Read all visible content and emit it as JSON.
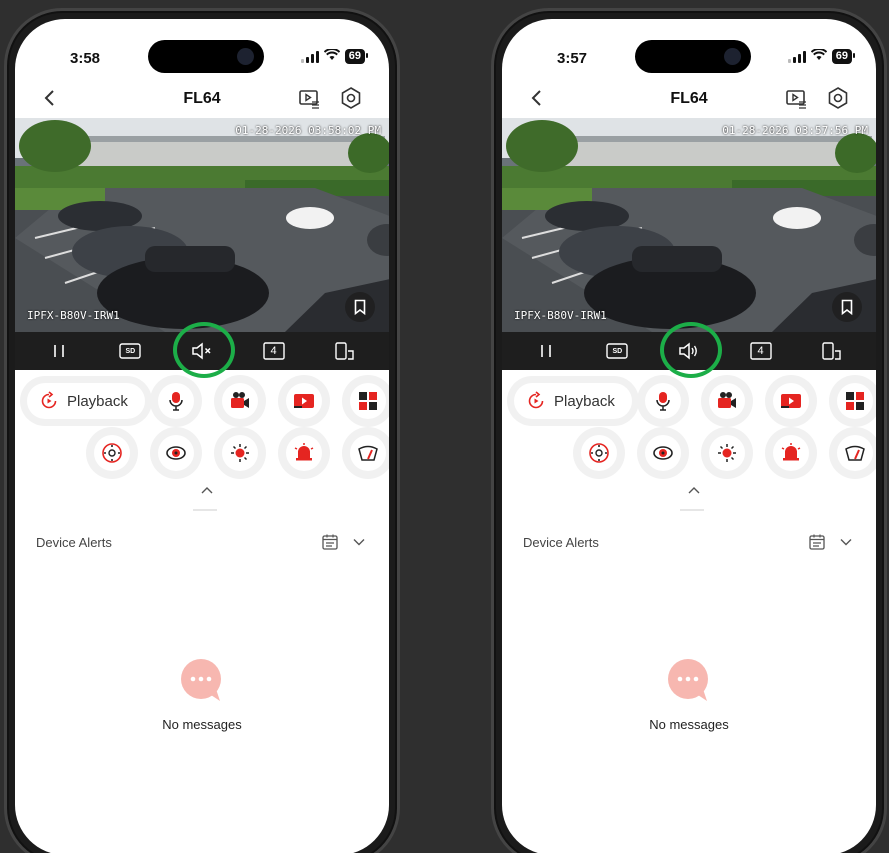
{
  "phones": [
    {
      "status": {
        "time": "3:58",
        "battery": "69"
      },
      "nav": {
        "title": "FL64"
      },
      "video": {
        "timestamp": "01-28-2026 03:58:02 PM",
        "camera_label": "IPFX-B80V-IRW1"
      },
      "controls": {
        "quality": "SD",
        "audio_state": "muted",
        "split_count": "4"
      },
      "functions": {
        "playback_label": "Playback"
      },
      "alerts": {
        "title": "Device Alerts",
        "empty_text": "No messages"
      }
    },
    {
      "status": {
        "time": "3:57",
        "battery": "69"
      },
      "nav": {
        "title": "FL64"
      },
      "video": {
        "timestamp": "01-28-2026 03:57:56 PM",
        "camera_label": "IPFX-B80V-IRW1"
      },
      "controls": {
        "quality": "SD",
        "audio_state": "unmuted",
        "split_count": "4"
      },
      "functions": {
        "playback_label": "Playback"
      },
      "alerts": {
        "title": "Device Alerts",
        "empty_text": "No messages"
      }
    }
  ],
  "colors": {
    "highlight": "#1cae48",
    "accent_red": "#e52521",
    "bubble_pink": "#f7b7b0"
  },
  "icons": {
    "function_row1": [
      "microphone-icon",
      "video-record-icon",
      "snapshot-play-icon",
      "multi-view-icon"
    ],
    "function_row2": [
      "ptz-icon",
      "eye-icon",
      "light-icon",
      "alarm-icon",
      "wiper-icon"
    ]
  }
}
